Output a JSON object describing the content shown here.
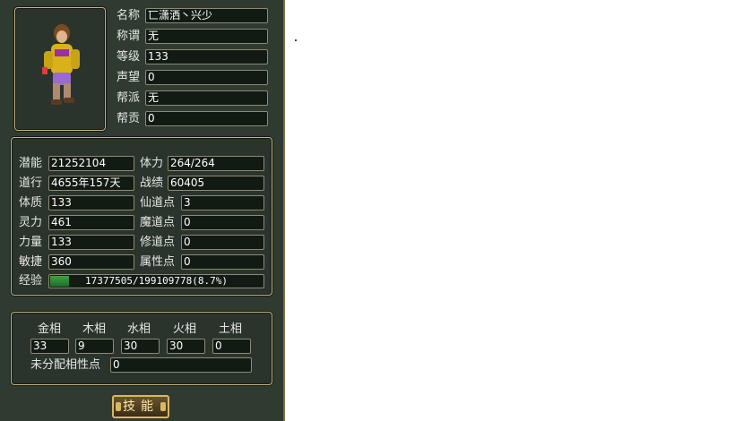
{
  "profile": {
    "name_label": "名称",
    "name": "匸潇洒丶兴少",
    "title_label": "称谓",
    "title": "无",
    "level_label": "等级",
    "level": "133",
    "prestige_label": "声望",
    "prestige": "0",
    "faction_label": "帮派",
    "faction": "无",
    "contribution_label": "帮贡",
    "contribution": "0"
  },
  "stats": {
    "potential_label": "潜能",
    "potential": "21252104",
    "stamina_label": "体力",
    "stamina": "264/264",
    "dao_label": "道行",
    "dao": "4655年157天",
    "merit_label": "战绩",
    "merit": "60405",
    "constitution_label": "体质",
    "constitution": "133",
    "immortal_label": "仙道点",
    "immortal": "3",
    "spirit_label": "灵力",
    "spirit": "461",
    "demon_label": "魔道点",
    "demon": "0",
    "strength_label": "力量",
    "strength": "133",
    "cultivation_label": "修道点",
    "cultivation": "0",
    "agility_label": "敏捷",
    "agility": "360",
    "attribute_label": "属性点",
    "attribute": "0",
    "exp_label": "经验",
    "exp_text": "17377505/199109778(8.7%)",
    "exp_fraction": 0.087
  },
  "elements": {
    "labels": [
      "金相",
      "木相",
      "水相",
      "火相",
      "土相"
    ],
    "values": [
      "33",
      "9",
      "30",
      "30",
      "0"
    ],
    "unassigned_label": "未分配相性点",
    "unassigned": "0"
  },
  "skill_button_label": "技能",
  "colors": {
    "panel_bg": "#2f3a31",
    "frame_gold": "#c8b680",
    "exp_green": "#3fa24a"
  }
}
